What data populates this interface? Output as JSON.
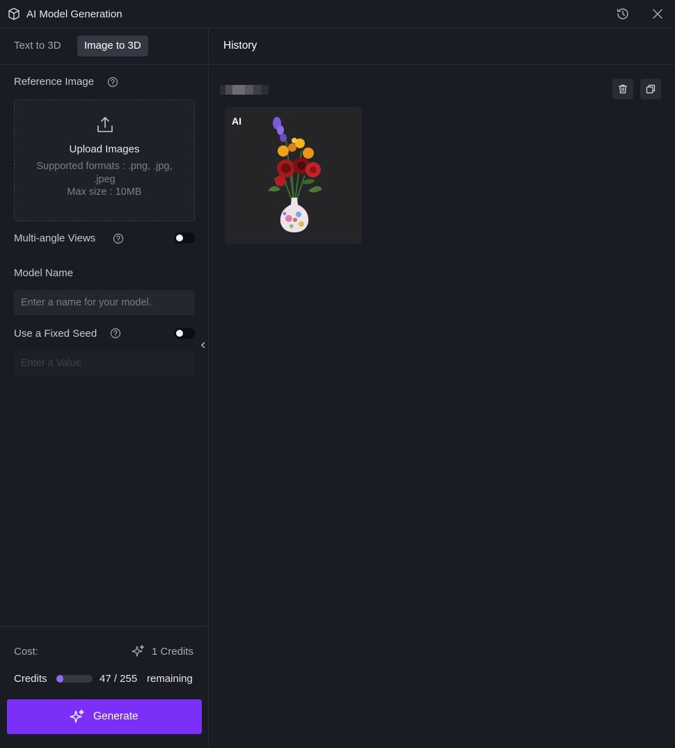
{
  "window": {
    "title": "AI Model Generation",
    "icons": {
      "app": "cube-icon",
      "history": "history-icon",
      "close": "close-icon"
    }
  },
  "tabs": [
    {
      "label": "Text to 3D",
      "active": false
    },
    {
      "label": "Image to 3D",
      "active": true
    }
  ],
  "reference_image": {
    "label": "Reference Image",
    "upload_title": "Upload Images",
    "formats": "Supported formats : .png, .jpg, .jpeg",
    "max_size": "Max size : 10MB"
  },
  "multi_angle": {
    "label": "Multi-angle Views",
    "enabled": false
  },
  "model_name": {
    "label": "Model Name",
    "value": "",
    "placeholder": "Enter a name for your model."
  },
  "fixed_seed": {
    "label": "Use a Fixed Seed",
    "enabled": false,
    "value": "",
    "placeholder": "Enter a Value"
  },
  "cost": {
    "label": "Cost:",
    "value": "1 Credits"
  },
  "credits": {
    "label": "Credits",
    "value": "47 / 255",
    "suffix": "remaining",
    "used_fraction": 0.184
  },
  "generate": {
    "label": "Generate"
  },
  "history": {
    "title": "History",
    "items": [
      {
        "tag": "AI",
        "thumbnail": "flower-vase-model"
      }
    ]
  },
  "colors": {
    "accent": "#7b2ff7",
    "progress": "#8b6cf6",
    "background": "#1a1c23"
  }
}
